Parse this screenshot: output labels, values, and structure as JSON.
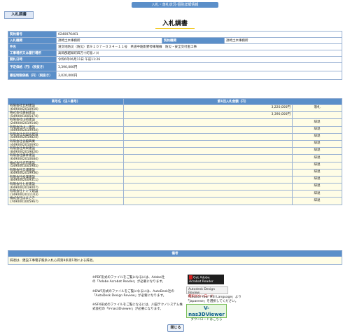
{
  "header": {
    "title": "入札・落札状況-個別詳細情報"
  },
  "tab": {
    "label": "入札調書"
  },
  "page": {
    "title": "入札調書"
  },
  "info": {
    "contract_no_label": "契約番号",
    "contract_no": "0240076401",
    "dept_label": "入札機関",
    "dept": "須崎土木事務所",
    "contract_dept_label": "契約機関",
    "contract_dept": "須崎土木事務所",
    "name_label": "件名",
    "name": "道交地防災（防災）第９１０７－０３４－１１号　県道中筋影野停車場線　防災・安全交付金工事",
    "place_label": "工事場所又は履行場所",
    "place": "高岡郡越知町四万十町島ノ川",
    "date_label": "開札日時",
    "date": "令和6年06月11日 午前11:26",
    "planned_label": "予定価格（円）（税抜き）",
    "planned": "3,390,000円",
    "min_label": "最低制限価格（円）（税抜き）",
    "min": "3,020,000円"
  },
  "bids": {
    "col1": "商号名（法人番号）",
    "col2": "第1回入札金額（円）",
    "rows": [
      {
        "name": "有限会社北村建設",
        "id": "(6490002010950)",
        "amount": "3,220,000円",
        "result": "落札"
      },
      {
        "name": "株式会社藤田建設",
        "id": "(5490001005474)",
        "amount": "3,390,000円",
        "result": ""
      },
      {
        "name": "有限会社山﨑建設",
        "id": "(2490002019546)",
        "amount": "",
        "result": "辞退"
      },
      {
        "name": "有限会社山一建設",
        "id": "(4490002019944)",
        "amount": "",
        "result": "辞退"
      },
      {
        "name": "有限会社北国光建設",
        "id": "(5490002019824)",
        "amount": "",
        "result": "辞退"
      },
      {
        "name": "有限会社谷脇興業",
        "id": "(4490002010695)",
        "amount": "",
        "result": "辞退"
      },
      {
        "name": "有限会社共栄建設",
        "id": "(8490002019820)",
        "amount": "",
        "result": "辞退"
      },
      {
        "name": "有限会社藤井建設",
        "id": "(6490002010684)",
        "amount": "",
        "result": "辞退"
      },
      {
        "name": "株式会社武市建設",
        "id": "(5490001005985)",
        "amount": "",
        "result": "辞退"
      },
      {
        "name": "有限会社三浦建設",
        "id": "(6490002019936)",
        "amount": "",
        "result": "辞退"
      },
      {
        "name": "有限会社松澤建設",
        "id": "(8490002009311)",
        "amount": "",
        "result": "辞退"
      },
      {
        "name": "有限会社七星建設",
        "id": "(6490002019007)",
        "amount": "",
        "result": "辞退"
      },
      {
        "name": "有限会社トシマ建設",
        "id": "(1490002011103)",
        "amount": "",
        "result": "辞退"
      },
      {
        "name": "株式会社はまさき",
        "id": "(7490001005967)",
        "amount": "",
        "result": "辞退"
      }
    ]
  },
  "remarks": {
    "label": "備考",
    "text": "辞退は、建設工事電子競争入札心得第8条第1項による辞退。"
  },
  "notes": {
    "pdf": "※PDF形式のファイルをご覧になるには、Adobe社の「Adobe Acrobat Reader」が必要になります。",
    "dwf": "※DWF形式のファイルをご覧になるには、AutoDesk社の「AutoDesk Design Review」が必要になります。",
    "sfx": "※SFX形式のファイルをご覧になるには、川田テクノシステム株式会社の「V-nas3Dviewer」が必要になります。"
  },
  "badges": {
    "adobe_1": "Get Adobe",
    "adobe_2": "Acrobat Reader",
    "ad_1": "Autodesk Design Review",
    "ad_2": "無料ダウンロード",
    "ad_3": "「Choose Your MSI Language」より",
    "ad_4": "「Japanese」を選択してください。",
    "vnas_1": "V-nas3DViewer",
    "vnas_2": "ダウンロードはこちら"
  },
  "close": {
    "label": "閉じる"
  }
}
